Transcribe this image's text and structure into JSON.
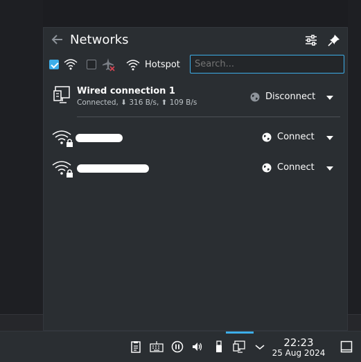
{
  "header": {
    "title": "Networks"
  },
  "toolbar": {
    "hotspot_label": "Hotspot",
    "search_placeholder": "Search...",
    "wifi_enabled": true,
    "airplane_mode": false
  },
  "connections": {
    "wired": {
      "name": "Wired connection 1",
      "status": "Connected, ⬇ 316 B/s, ⬆ 109 B/s",
      "action": "Disconnect"
    },
    "wifi": [
      {
        "action": "Connect",
        "secured": true
      },
      {
        "action": "Connect",
        "secured": true
      }
    ]
  },
  "taskbar": {
    "time": "22:23",
    "date": "25 Aug 2024"
  },
  "colors": {
    "accent": "#3daee9",
    "panel": "#2a2e32",
    "text": "#fcfcfc"
  }
}
